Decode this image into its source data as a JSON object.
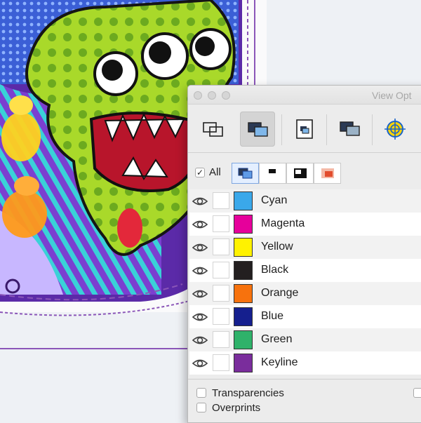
{
  "window": {
    "title": "View Opt"
  },
  "toolbar": {
    "buttons": [
      {
        "name": "separations-view",
        "icon": "stacked-rectangles-icon",
        "active": false
      },
      {
        "name": "composite-view",
        "icon": "filled-stacked-rectangles-icon",
        "active": true
      },
      {
        "name": "plate-view",
        "icon": "inset-plate-icon",
        "active": false
      },
      {
        "name": "overlap-view",
        "icon": "shadow-rectangles-icon",
        "active": false
      },
      {
        "name": "registration-view",
        "icon": "registration-target-icon",
        "active": false
      }
    ]
  },
  "filter": {
    "all_label": "All",
    "all_checked": true,
    "segments": [
      "composite-icon",
      "black-top-icon",
      "black-corner-icon",
      "red-preview-icon"
    ]
  },
  "inks": [
    {
      "name": "Cyan",
      "color": "#3aa8ea"
    },
    {
      "name": "Magenta",
      "color": "#e6009b"
    },
    {
      "name": "Yellow",
      "color": "#fff200"
    },
    {
      "name": "Black",
      "color": "#231f20"
    },
    {
      "name": "Orange",
      "color": "#f7720d"
    },
    {
      "name": "Blue",
      "color": "#151f8e"
    },
    {
      "name": "Green",
      "color": "#2fb26a"
    },
    {
      "name": "Keyline",
      "color": "#7a2d9c"
    }
  ],
  "options": {
    "transparencies_label": "Transparencies",
    "overprints_label": "Overprints"
  }
}
